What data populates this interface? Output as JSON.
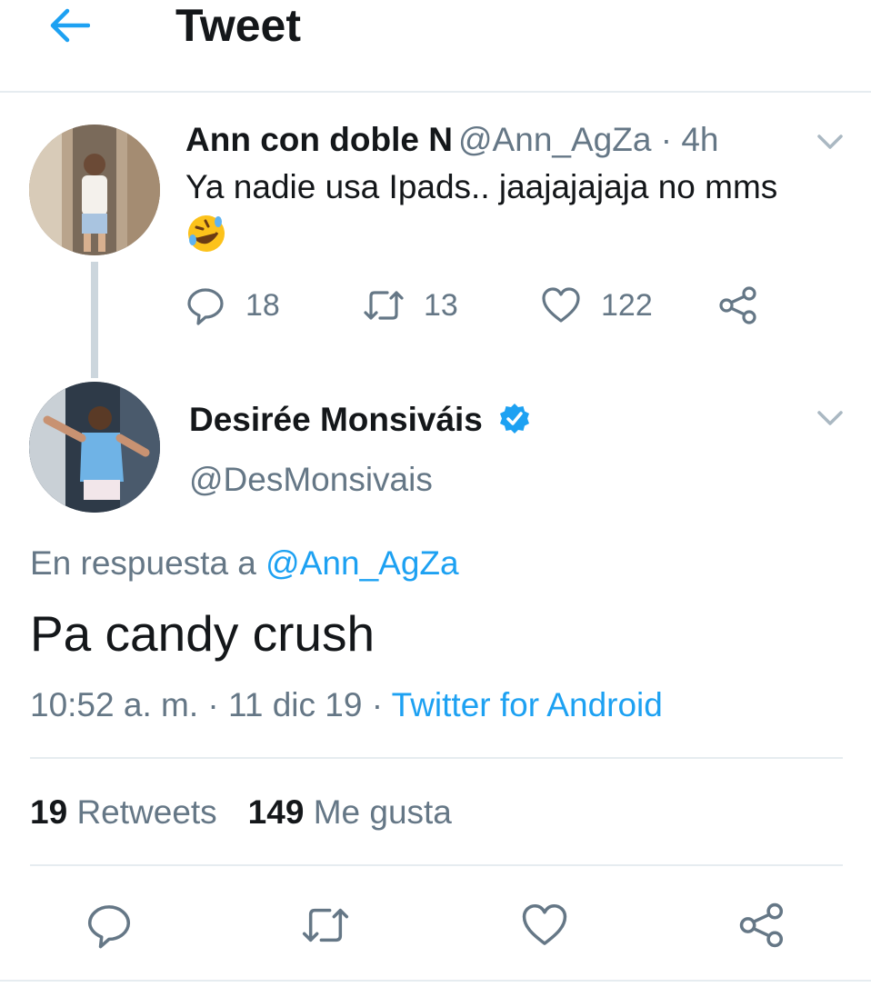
{
  "header": {
    "title": "Tweet"
  },
  "parent_tweet": {
    "display_name": "Ann con doble N",
    "handle": "@Ann_AgZa",
    "separator": "·",
    "time": "4h",
    "text": "Ya nadie usa Ipads.. jaajajajaja no mms",
    "emoji": "rolling-on-floor-laughing",
    "replies": "18",
    "retweets": "13",
    "likes": "122"
  },
  "main_tweet": {
    "display_name": "Desirée Monsiváis",
    "handle": "@DesMonsivais",
    "reply_prefix": "En respuesta a ",
    "reply_to": "@Ann_AgZa",
    "text": "Pa candy crush",
    "time": "10:52 a. m.",
    "date": "11 dic 19",
    "separator": "·",
    "source": "Twitter for Android",
    "retweet_count": "19",
    "retweet_label": "Retweets",
    "like_count": "149",
    "like_label": "Me gusta"
  },
  "colors": {
    "accent": "#1da1f2",
    "secondary_text": "#657786",
    "divider": "#e6ecf0",
    "thread_line": "#ccd6dd"
  },
  "icons": [
    "back-arrow-icon",
    "chevron-down-icon",
    "reply-icon",
    "retweet-icon",
    "like-icon",
    "share-icon",
    "verified-badge-icon"
  ]
}
